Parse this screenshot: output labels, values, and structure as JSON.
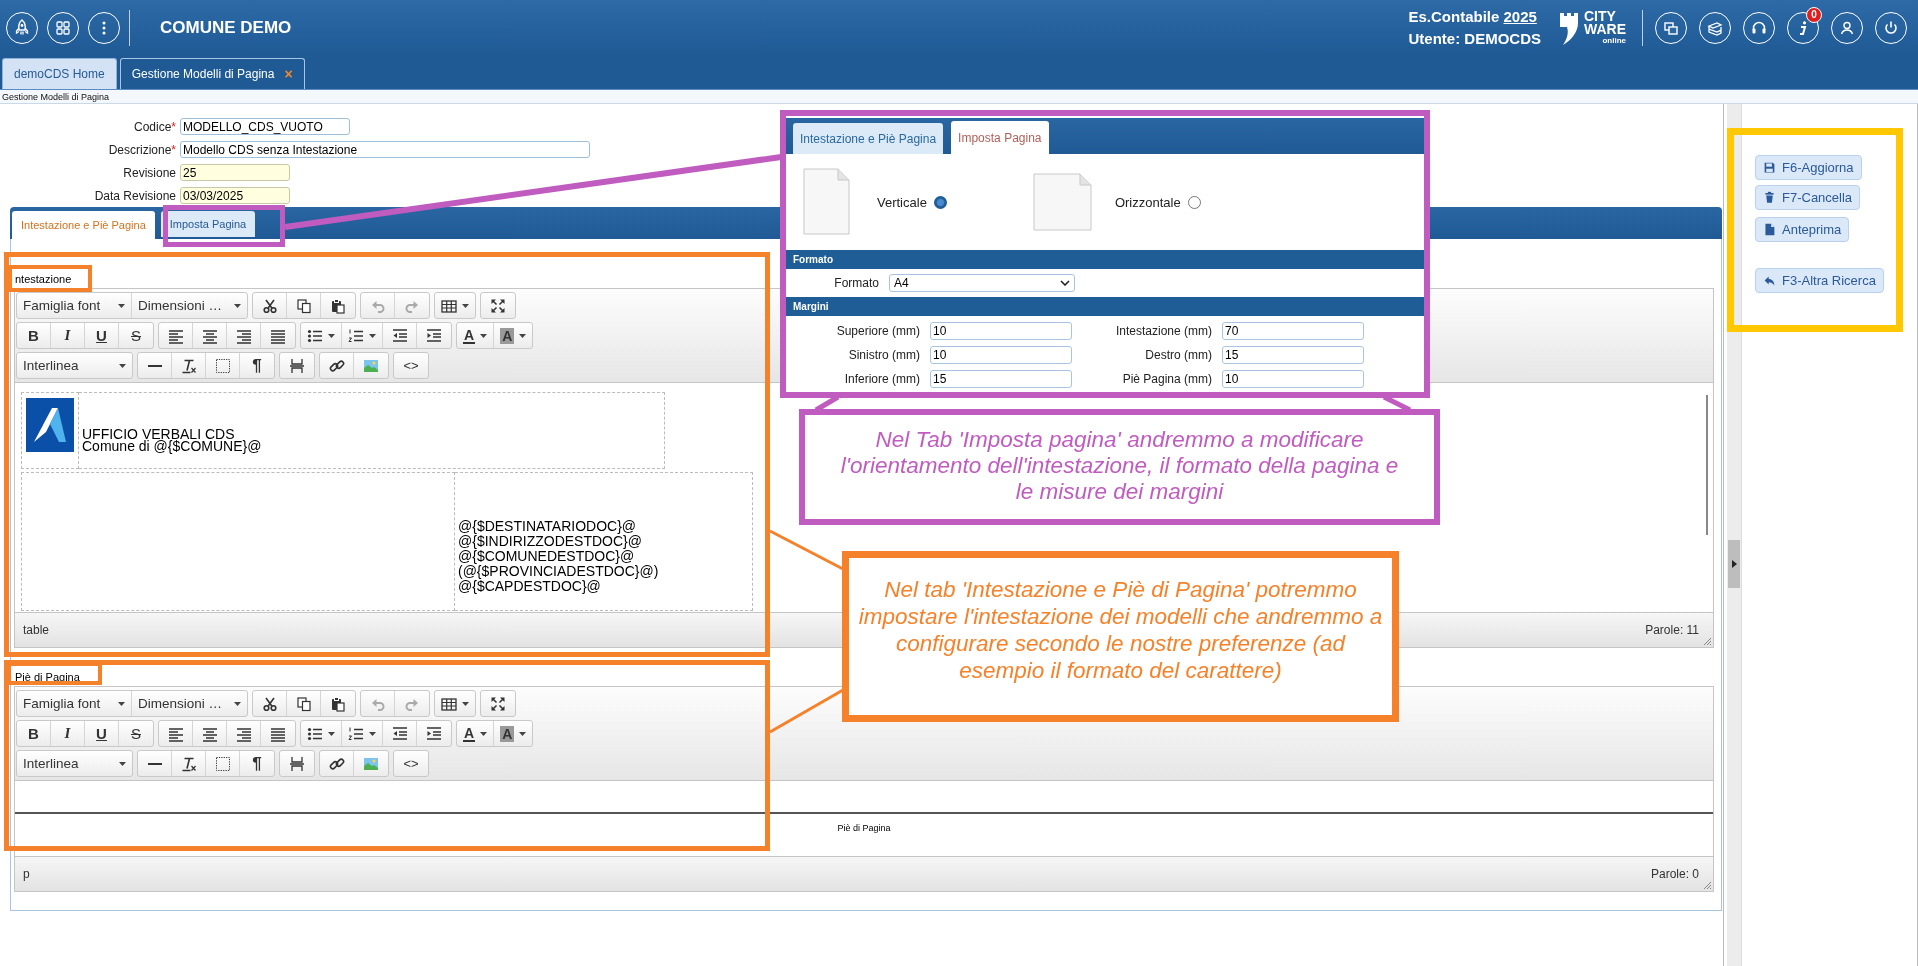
{
  "header": {
    "title": "COMUNE DEMO",
    "year_label": "Es.Contabile",
    "year": "2025",
    "user": "Utente: DEMOCDS",
    "logo": [
      "CITY",
      "WARE",
      "online"
    ],
    "badge": "0"
  },
  "doc_tabs": [
    {
      "label": "demoCDS Home",
      "selected": false
    },
    {
      "label": "Gestione Modelli di Pagina",
      "selected": true,
      "close": "×"
    }
  ],
  "breadcrumb": "Gestione Modelli di Pagina",
  "form": [
    {
      "label": "Codice",
      "mark": "*",
      "value": "MODELLO_CDS_VUOTO",
      "readonly": false
    },
    {
      "label": "Descrizione",
      "mark": "*",
      "value": "Modello CDS senza Intestazione",
      "readonly": false
    },
    {
      "label": "Revisione",
      "value": "25",
      "readonly": true
    },
    {
      "label": "Data Revisione",
      "value": "03/03/2025",
      "readonly": true
    }
  ],
  "page_tabs": [
    {
      "label": "Intestazione e Piè Pagina",
      "selected": true
    },
    {
      "label": "Imposta Pagina",
      "selected": false
    }
  ],
  "editors": [
    {
      "kind": "table",
      "label": "ntestazione",
      "toolbar": {
        "font_family": "Famiglia font",
        "font_size": "Dimensioni …",
        "line_height": "Interlinea",
        "bold": "B",
        "italic": "I",
        "underline": "U",
        "strike": "S",
        "text_color": "A",
        "highlight": "A",
        "pilcrow": "¶",
        "source": "<>",
        "history_disabled": true
      },
      "letterhead": [
        "UFFICIO VERBALI CDS",
        "Comune di @{$COMUNE}@"
      ],
      "address": [
        "@{$DESTINATARIODOC}@",
        "@{$INDIRIZZODESTDOC}@",
        "@{$COMUNEDESTDOC}@",
        "(@{$PROVINCIADESTDOC}@)",
        "@{$CAPDESTDOC}@"
      ],
      "path": "table",
      "words": "Parole: 11"
    },
    {
      "kind": "footer",
      "label": "Piè di Pagina",
      "toolbar": {
        "font_family": "Famiglia font",
        "font_size": "Dimensioni …",
        "line_height": "Interlinea",
        "bold": "B",
        "italic": "I",
        "underline": "U",
        "strike": "S",
        "text_color": "A",
        "highlight": "A",
        "pilcrow": "¶",
        "source": "<>",
        "history_disabled": true
      },
      "footer": "Piè di Pagina",
      "path": "p",
      "words": "Parole: 0"
    }
  ],
  "actions": [
    {
      "kind": "save",
      "label": "F6-Aggiorna"
    },
    {
      "kind": "delete",
      "label": "F7-Cancella"
    },
    {
      "kind": "preview",
      "label": "Anteprima"
    },
    {
      "kind": "back",
      "label": "F3-Altra Ricerca"
    }
  ],
  "inset": {
    "tabs": [
      {
        "label": "Intestazione e Piè Pagina",
        "selected": false
      },
      {
        "label": "Imposta Pagina",
        "selected": true
      }
    ],
    "orientation": [
      {
        "kind": "portrait",
        "label": "Verticale",
        "selected": true
      },
      {
        "kind": "landscape",
        "label": "Orizzontale",
        "selected": false
      }
    ],
    "format_section": "Formato",
    "format_label": "Formato",
    "format_value": "A4",
    "margins_section": "Margini",
    "margins": [
      {
        "label": "Superiore (mm)",
        "value": "10"
      },
      {
        "label": "Intestazione (mm)",
        "value": "70"
      },
      {
        "label": "Sinistro (mm)",
        "value": "10"
      },
      {
        "label": "Destro (mm)",
        "value": "15"
      },
      {
        "label": "Inferiore (mm)",
        "value": "15"
      },
      {
        "label": "Piè Pagina (mm)",
        "value": "10"
      }
    ]
  },
  "callouts": [
    {
      "text": "Nel Tab 'Imposta pagina' andremmo a modificare l'orientamento dell'intestazione, il formato della pagina e le misure dei margini",
      "color": "#c05cc0"
    },
    {
      "text": "Nel tab 'Intestazione e Piè di Pagina' potremmo impostare l'intestazione dei modelli che andremmo a configurare secondo le nostre preferenze (ad esempio il formato del carattere)",
      "color": "#f5822a"
    }
  ]
}
